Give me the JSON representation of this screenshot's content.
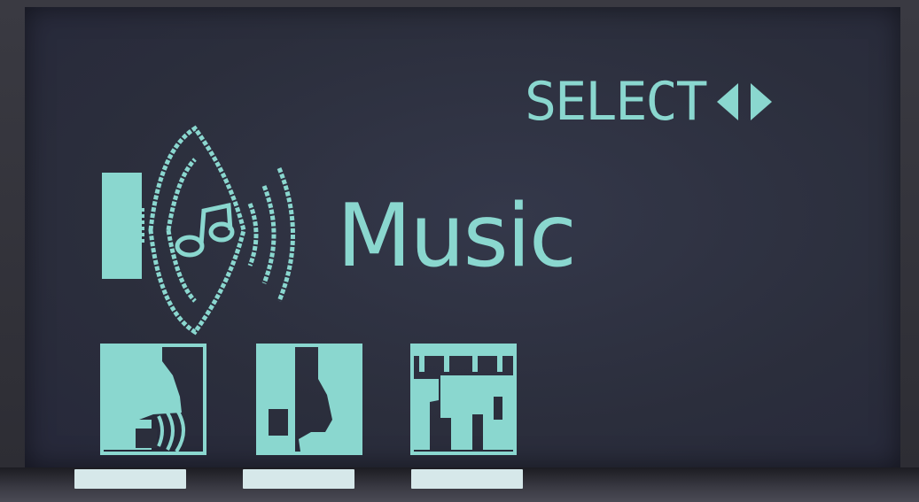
{
  "header": {
    "select_label": "SELECT",
    "left_arrow_icon": "left-triangle",
    "right_arrow_icon": "right-triangle"
  },
  "mode": {
    "label": "Music",
    "icon": "speaker-music-note-icon"
  },
  "tiles": [
    {
      "name": "stage-speaker-mode",
      "icon": "speaker-in-room-icon"
    },
    {
      "name": "chair-music-mode",
      "icon": "chair-with-note-icon"
    },
    {
      "name": "venue-mode",
      "icon": "building-icon"
    }
  ],
  "colors": {
    "lcd_text": "#8ad7cf",
    "lcd_background": "#2b2e3c"
  }
}
